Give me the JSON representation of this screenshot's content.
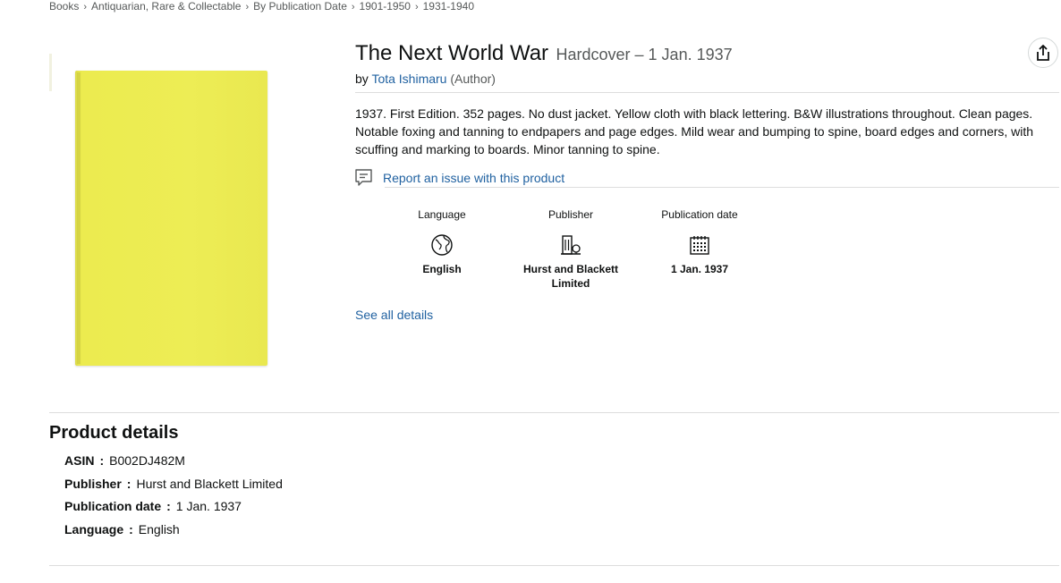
{
  "breadcrumb": [
    "Books",
    "Antiquarian, Rare & Collectable",
    "By Publication Date",
    "1901-1950",
    "1931-1940"
  ],
  "product": {
    "title": "The Next World War",
    "format": "Hardcover – 1 Jan. 1937",
    "by_label": "by",
    "author": "Tota Ishimaru",
    "author_role": "(Author)",
    "description": "1937. First Edition. 352 pages. No dust jacket. Yellow cloth with black lettering. B&W illustrations throughout. Clean pages. Notable foxing and tanning to endpapers and page edges. Mild wear and bumping to spine, board edges and corners, with scuffing and marking to boards. Minor tanning to spine.",
    "report_link": "Report an issue with this product",
    "cover_color": "#ebea4f"
  },
  "attributes": [
    {
      "label": "Language",
      "icon": "globe-icon",
      "value": "English"
    },
    {
      "label": "Publisher",
      "icon": "building-icon",
      "value": "Hurst and Blackett Limited"
    },
    {
      "label": "Publication date",
      "icon": "calendar-icon",
      "value": "1 Jan. 1937"
    }
  ],
  "see_all_details": "See all details",
  "product_details": {
    "heading": "Product details",
    "rows": [
      {
        "key": "ASIN",
        "value": "B002DJ482M"
      },
      {
        "key": "Publisher",
        "value": "Hurst and Blackett Limited"
      },
      {
        "key": "Publication date",
        "value": "1 Jan. 1937"
      },
      {
        "key": "Language",
        "value": "English"
      }
    ]
  },
  "colors": {
    "link": "#2162a1",
    "text": "#0f1111",
    "muted": "#565959",
    "divider": "#dddddd"
  }
}
